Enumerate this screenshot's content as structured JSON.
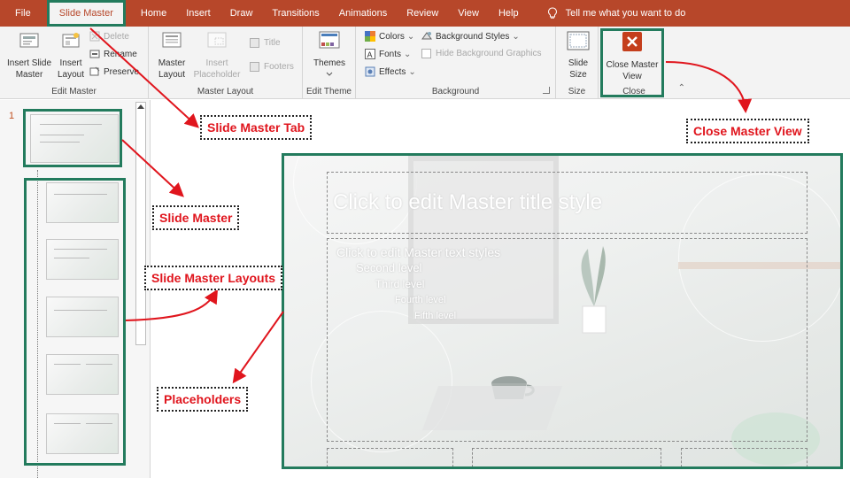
{
  "tabs": [
    "File",
    "Slide Master",
    "Home",
    "Insert",
    "Draw",
    "Transitions",
    "Animations",
    "Review",
    "View",
    "Help"
  ],
  "tell_me": "Tell me what you want to do",
  "ribbon": {
    "edit_master": {
      "label": "Edit Master",
      "insert_slide_master": "Insert Slide Master",
      "insert_layout": "Insert Layout",
      "delete": "Delete",
      "rename": "Rename",
      "preserve": "Preserve"
    },
    "master_layout": {
      "label": "Master Layout",
      "master_layout_btn": "Master Layout",
      "insert_placeholder": "Insert Placeholder",
      "title": "Title",
      "footers": "Footers"
    },
    "edit_theme": {
      "label": "Edit Theme",
      "themes": "Themes"
    },
    "background": {
      "label": "Background",
      "colors": "Colors",
      "fonts": "Fonts",
      "effects": "Effects",
      "background_styles": "Background Styles",
      "hide_background_graphics": "Hide Background Graphics"
    },
    "size": {
      "label": "Size",
      "slide_size": "Slide Size"
    },
    "close": {
      "label": "Close",
      "close_master_view": "Close Master View"
    }
  },
  "thumbnail_pane": {
    "slide_number": "1"
  },
  "slide": {
    "title_placeholder": "Click to edit Master title style",
    "body_levels": [
      "Click to edit Master text styles",
      "Second level",
      "Third level",
      "Fourth level",
      "Fifth level"
    ]
  },
  "callouts": {
    "slide_master_tab": "Slide Master Tab",
    "close_master_view": "Close Master View",
    "slide_master": "Slide Master",
    "slide_master_layouts": "Slide Master Layouts",
    "placeholders": "Placeholders"
  },
  "colors": {
    "tab_bar": "#b7472a",
    "highlight_border": "#237b5d",
    "callout_text": "#e0151d",
    "close_icon": "#c43e1c"
  }
}
